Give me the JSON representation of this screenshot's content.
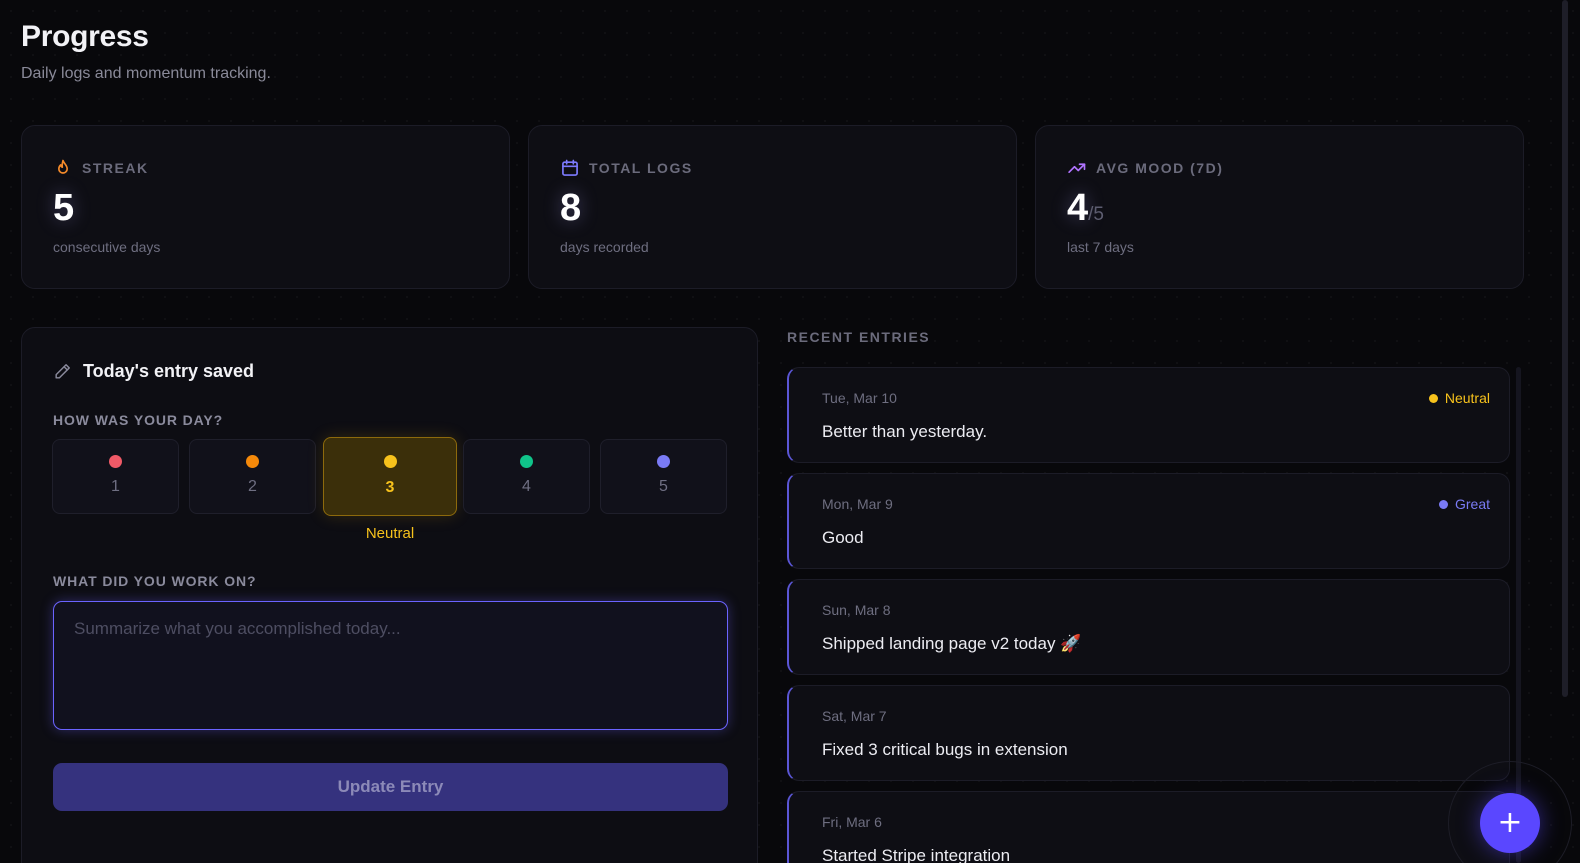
{
  "header": {
    "title": "Progress",
    "subtitle": "Daily logs and momentum tracking."
  },
  "stats": [
    {
      "label": "STREAK",
      "icon": "flame-icon",
      "value": "5",
      "sub": "consecutive days",
      "color": "#f58a2a"
    },
    {
      "label": "TOTAL LOGS",
      "icon": "calendar-icon",
      "value": "8",
      "sub": "days recorded",
      "color": "#7d7bff"
    },
    {
      "label": "AVG MOOD (7D)",
      "icon": "trending-up-icon",
      "value": "4",
      "denom": "/5",
      "sub": "last 7 days",
      "color": "#b073ff"
    }
  ],
  "entry_form": {
    "title": "Today's entry saved",
    "mood_question": "HOW WAS YOUR DAY?",
    "moods": [
      {
        "value": "1",
        "color": "#f05a67"
      },
      {
        "value": "2",
        "color": "#f5890a"
      },
      {
        "value": "3",
        "color": "#f7c21c"
      },
      {
        "value": "4",
        "color": "#10c48a"
      },
      {
        "value": "5",
        "color": "#7a7bf5"
      }
    ],
    "selected_mood": "3",
    "selected_caption": "Neutral",
    "work_question": "WHAT DID YOU WORK ON?",
    "work_placeholder": "Summarize what you accomplished today...",
    "work_value": "",
    "submit_label": "Update Entry"
  },
  "recent": {
    "label": "RECENT ENTRIES",
    "entries": [
      {
        "date": "Tue, Mar 10",
        "text": "Better than yesterday.",
        "mood": "Neutral",
        "mood_color": "#f7c21c"
      },
      {
        "date": "Mon, Mar 9",
        "text": "Good",
        "mood": "Great",
        "mood_color": "#7a7bf5"
      },
      {
        "date": "Sun, Mar 8",
        "text": "Shipped landing page v2 today 🚀",
        "mood": "",
        "mood_color": ""
      },
      {
        "date": "Sat, Mar 7",
        "text": "Fixed 3 critical bugs in extension",
        "mood": "",
        "mood_color": ""
      },
      {
        "date": "Fri, Mar 6",
        "text": "Started Stripe integration",
        "mood": "",
        "mood_color": ""
      }
    ]
  },
  "fab": {
    "icon": "plus-icon",
    "glyph": "+"
  }
}
